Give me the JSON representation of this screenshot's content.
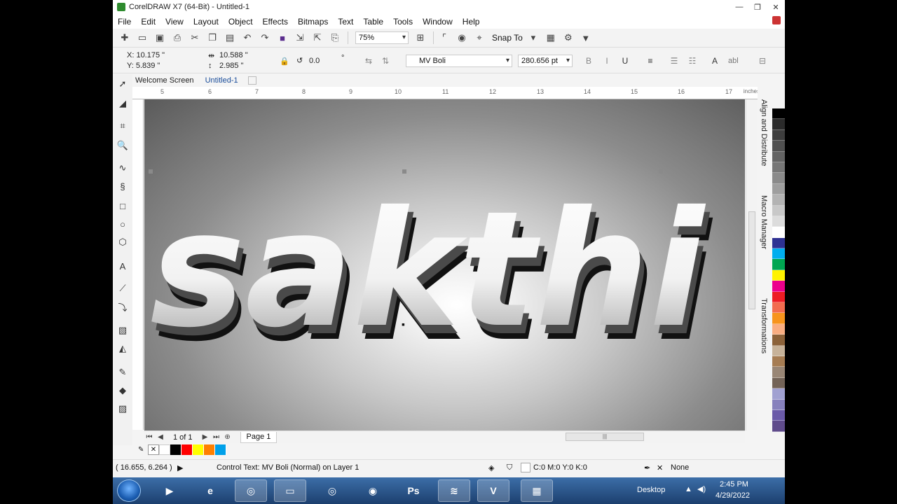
{
  "window": {
    "title": "CorelDRAW X7 (64-Bit) - Untitled-1",
    "controls": [
      "—",
      "❐",
      "✕"
    ]
  },
  "menu": [
    "File",
    "Edit",
    "View",
    "Layout",
    "Object",
    "Effects",
    "Bitmaps",
    "Text",
    "Table",
    "Tools",
    "Window",
    "Help"
  ],
  "toolbar": {
    "zoom": "75%",
    "snap_to": "Snap To"
  },
  "property_bar": {
    "x": "X: 10.175 \"",
    "y": "Y: 5.839 \"",
    "width": "10.588 \"",
    "height": "2.985 \"",
    "rotation": "0.0",
    "degree": "°",
    "font": "MV Boli",
    "font_size": "280.656 pt",
    "text_frame_label": "abl"
  },
  "doc_tabs": [
    "Welcome Screen",
    "Untitled-1"
  ],
  "ruler": {
    "labels": [
      "5",
      "6",
      "7",
      "8",
      "9",
      "10",
      "11",
      "12",
      "13",
      "14",
      "15",
      "16",
      "17"
    ],
    "unit": "inches"
  },
  "canvas": {
    "text": "sakthi"
  },
  "dockers": [
    "Align and Distribute",
    "Macro Manager",
    "Transformations"
  ],
  "palette_colors": [
    "#000000",
    "#2b2b2b",
    "#3d3d3d",
    "#505050",
    "#636363",
    "#767676",
    "#8a8a8a",
    "#9e9e9e",
    "#b3b3b3",
    "#c8c8c8",
    "#dcdcdc",
    "#ffffff",
    "#2e3192",
    "#00aeef",
    "#00a651",
    "#fff200",
    "#ec008c",
    "#ed1c24",
    "#f26c4f",
    "#f7941d",
    "#f9ad81",
    "#8c6239",
    "#c7b299",
    "#a67c52",
    "#998675",
    "#736357",
    "#a1a1d1",
    "#8781bd",
    "#6a5aa8",
    "#5f4b8b"
  ],
  "page_nav": {
    "page_count": "1 of 1",
    "page_tab": "Page 1"
  },
  "document_palette": [
    "#000000",
    "#ff0000",
    "#ffff00",
    "#ff8000",
    "#00a0e9"
  ],
  "status": {
    "cursor": "( 16.655, 6.264 )",
    "info": "Control Text: MV Boli (Normal) on Layer 1",
    "fill": "C:0 M:0 Y:0 K:0",
    "outline": "None"
  },
  "taskbar": {
    "desktop": "Desktop",
    "time": "2:45 PM",
    "date": "4/29/2022"
  }
}
